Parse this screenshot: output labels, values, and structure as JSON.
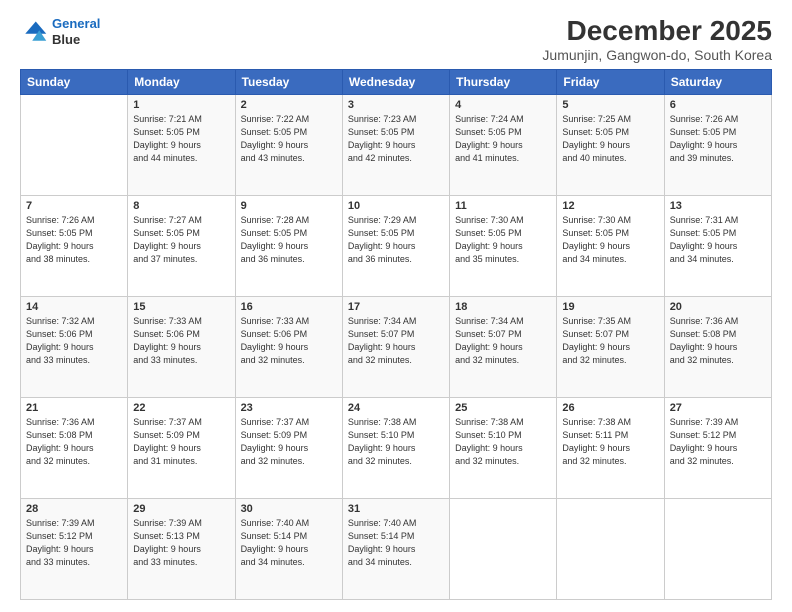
{
  "logo": {
    "line1": "General",
    "line2": "Blue"
  },
  "title": "December 2025",
  "subtitle": "Jumunjin, Gangwon-do, South Korea",
  "header": {
    "days": [
      "Sunday",
      "Monday",
      "Tuesday",
      "Wednesday",
      "Thursday",
      "Friday",
      "Saturday"
    ]
  },
  "weeks": [
    [
      {
        "num": "",
        "info": ""
      },
      {
        "num": "1",
        "info": "Sunrise: 7:21 AM\nSunset: 5:05 PM\nDaylight: 9 hours\nand 44 minutes."
      },
      {
        "num": "2",
        "info": "Sunrise: 7:22 AM\nSunset: 5:05 PM\nDaylight: 9 hours\nand 43 minutes."
      },
      {
        "num": "3",
        "info": "Sunrise: 7:23 AM\nSunset: 5:05 PM\nDaylight: 9 hours\nand 42 minutes."
      },
      {
        "num": "4",
        "info": "Sunrise: 7:24 AM\nSunset: 5:05 PM\nDaylight: 9 hours\nand 41 minutes."
      },
      {
        "num": "5",
        "info": "Sunrise: 7:25 AM\nSunset: 5:05 PM\nDaylight: 9 hours\nand 40 minutes."
      },
      {
        "num": "6",
        "info": "Sunrise: 7:26 AM\nSunset: 5:05 PM\nDaylight: 9 hours\nand 39 minutes."
      }
    ],
    [
      {
        "num": "7",
        "info": "Sunrise: 7:26 AM\nSunset: 5:05 PM\nDaylight: 9 hours\nand 38 minutes."
      },
      {
        "num": "8",
        "info": "Sunrise: 7:27 AM\nSunset: 5:05 PM\nDaylight: 9 hours\nand 37 minutes."
      },
      {
        "num": "9",
        "info": "Sunrise: 7:28 AM\nSunset: 5:05 PM\nDaylight: 9 hours\nand 36 minutes."
      },
      {
        "num": "10",
        "info": "Sunrise: 7:29 AM\nSunset: 5:05 PM\nDaylight: 9 hours\nand 36 minutes."
      },
      {
        "num": "11",
        "info": "Sunrise: 7:30 AM\nSunset: 5:05 PM\nDaylight: 9 hours\nand 35 minutes."
      },
      {
        "num": "12",
        "info": "Sunrise: 7:30 AM\nSunset: 5:05 PM\nDaylight: 9 hours\nand 34 minutes."
      },
      {
        "num": "13",
        "info": "Sunrise: 7:31 AM\nSunset: 5:05 PM\nDaylight: 9 hours\nand 34 minutes."
      }
    ],
    [
      {
        "num": "14",
        "info": "Sunrise: 7:32 AM\nSunset: 5:06 PM\nDaylight: 9 hours\nand 33 minutes."
      },
      {
        "num": "15",
        "info": "Sunrise: 7:33 AM\nSunset: 5:06 PM\nDaylight: 9 hours\nand 33 minutes."
      },
      {
        "num": "16",
        "info": "Sunrise: 7:33 AM\nSunset: 5:06 PM\nDaylight: 9 hours\nand 32 minutes."
      },
      {
        "num": "17",
        "info": "Sunrise: 7:34 AM\nSunset: 5:07 PM\nDaylight: 9 hours\nand 32 minutes."
      },
      {
        "num": "18",
        "info": "Sunrise: 7:34 AM\nSunset: 5:07 PM\nDaylight: 9 hours\nand 32 minutes."
      },
      {
        "num": "19",
        "info": "Sunrise: 7:35 AM\nSunset: 5:07 PM\nDaylight: 9 hours\nand 32 minutes."
      },
      {
        "num": "20",
        "info": "Sunrise: 7:36 AM\nSunset: 5:08 PM\nDaylight: 9 hours\nand 32 minutes."
      }
    ],
    [
      {
        "num": "21",
        "info": "Sunrise: 7:36 AM\nSunset: 5:08 PM\nDaylight: 9 hours\nand 32 minutes."
      },
      {
        "num": "22",
        "info": "Sunrise: 7:37 AM\nSunset: 5:09 PM\nDaylight: 9 hours\nand 31 minutes."
      },
      {
        "num": "23",
        "info": "Sunrise: 7:37 AM\nSunset: 5:09 PM\nDaylight: 9 hours\nand 32 minutes."
      },
      {
        "num": "24",
        "info": "Sunrise: 7:38 AM\nSunset: 5:10 PM\nDaylight: 9 hours\nand 32 minutes."
      },
      {
        "num": "25",
        "info": "Sunrise: 7:38 AM\nSunset: 5:10 PM\nDaylight: 9 hours\nand 32 minutes."
      },
      {
        "num": "26",
        "info": "Sunrise: 7:38 AM\nSunset: 5:11 PM\nDaylight: 9 hours\nand 32 minutes."
      },
      {
        "num": "27",
        "info": "Sunrise: 7:39 AM\nSunset: 5:12 PM\nDaylight: 9 hours\nand 32 minutes."
      }
    ],
    [
      {
        "num": "28",
        "info": "Sunrise: 7:39 AM\nSunset: 5:12 PM\nDaylight: 9 hours\nand 33 minutes."
      },
      {
        "num": "29",
        "info": "Sunrise: 7:39 AM\nSunset: 5:13 PM\nDaylight: 9 hours\nand 33 minutes."
      },
      {
        "num": "30",
        "info": "Sunrise: 7:40 AM\nSunset: 5:14 PM\nDaylight: 9 hours\nand 34 minutes."
      },
      {
        "num": "31",
        "info": "Sunrise: 7:40 AM\nSunset: 5:14 PM\nDaylight: 9 hours\nand 34 minutes."
      },
      {
        "num": "",
        "info": ""
      },
      {
        "num": "",
        "info": ""
      },
      {
        "num": "",
        "info": ""
      }
    ]
  ]
}
